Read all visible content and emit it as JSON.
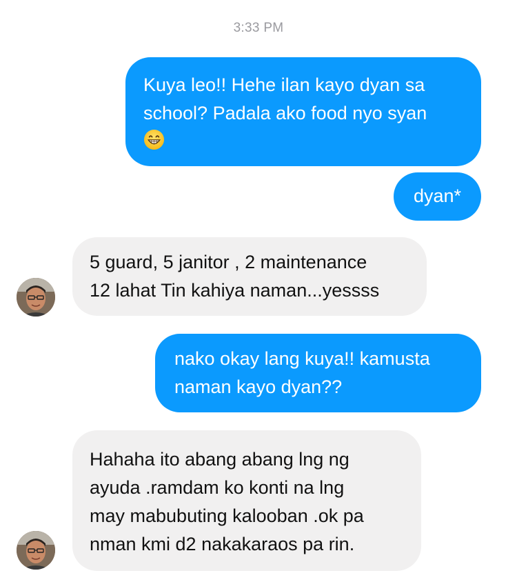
{
  "conversation": {
    "timestamp": "3:33 PM",
    "messages": [
      {
        "direction": "sent",
        "lines": [
          "Kuya leo!! Hehe ilan kayo dyan sa",
          "school? Padala ako food nyo syan"
        ],
        "emoji": "grinning-face-with-smiling-eyes"
      },
      {
        "direction": "sent",
        "lines": [
          "dyan*"
        ]
      },
      {
        "direction": "received",
        "lines": [
          "5 guard, 5 janitor , 2 maintenance",
          "12 lahat Tin kahiya naman...yessss"
        ]
      },
      {
        "direction": "sent",
        "lines": [
          "nako okay lang kuya!! kamusta",
          "naman kayo dyan??"
        ]
      },
      {
        "direction": "received",
        "lines": [
          "Hahaha ito abang abang lng ng",
          "ayuda .ramdam ko konti na lng",
          "may mabubuting kalooban .ok pa",
          "nman kmi d2 nakakaraos pa rin."
        ]
      }
    ]
  },
  "colors": {
    "sent_bubble": "#0b9afe",
    "received_bubble": "#f1f0f0",
    "timestamp": "#9a9a9f"
  }
}
